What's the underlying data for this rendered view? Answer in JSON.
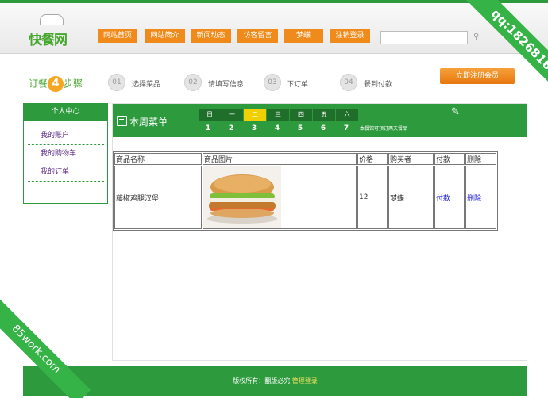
{
  "logo": {
    "text": "快餐网"
  },
  "nav": [
    "网站首页",
    "网站简介",
    "新闻动态",
    "访客留言",
    "梦蝶",
    "注销登录"
  ],
  "search": {
    "placeholder": ""
  },
  "steps": {
    "title_pre": "订餐",
    "title_num": "4",
    "title_post": "步骤",
    "items": [
      {
        "num": "01",
        "label": "选择菜品"
      },
      {
        "num": "02",
        "label": "请填写信息"
      },
      {
        "num": "03",
        "label": "下订单"
      },
      {
        "num": "04",
        "label": "餐到付款"
      }
    ],
    "register": "立即注册会员"
  },
  "sidebar": {
    "title": "个人中心",
    "items": [
      "我的账户",
      "我的购物车",
      "我的订单"
    ]
  },
  "menu": {
    "title": "本周菜单",
    "weekdays": [
      "日",
      "一",
      "二",
      "三",
      "四",
      "五",
      "六"
    ],
    "daynums": [
      "1",
      "2",
      "3",
      "4",
      "5",
      "6",
      "7"
    ],
    "active_index": 2,
    "note": "本餐馆可预订两天餐品"
  },
  "table": {
    "headers": [
      "商品名称",
      "商品图片",
      "价格",
      "购买者",
      "付款",
      "删除"
    ],
    "rows": [
      {
        "name": "藤椒鸡腿汉堡",
        "price": "12",
        "buyer": "梦蝶",
        "pay": "付款",
        "delete": "删除"
      }
    ]
  },
  "footer": {
    "text": "版权所有：翻版必究 ",
    "link": "管理登录"
  },
  "watermarks": {
    "top_right": "qq:1826816020",
    "bottom_left": "85work.com"
  },
  "colors": {
    "brand_green": "#2e9a3e",
    "nav_orange": "#f08a1a",
    "active_day": "#f0d000"
  }
}
